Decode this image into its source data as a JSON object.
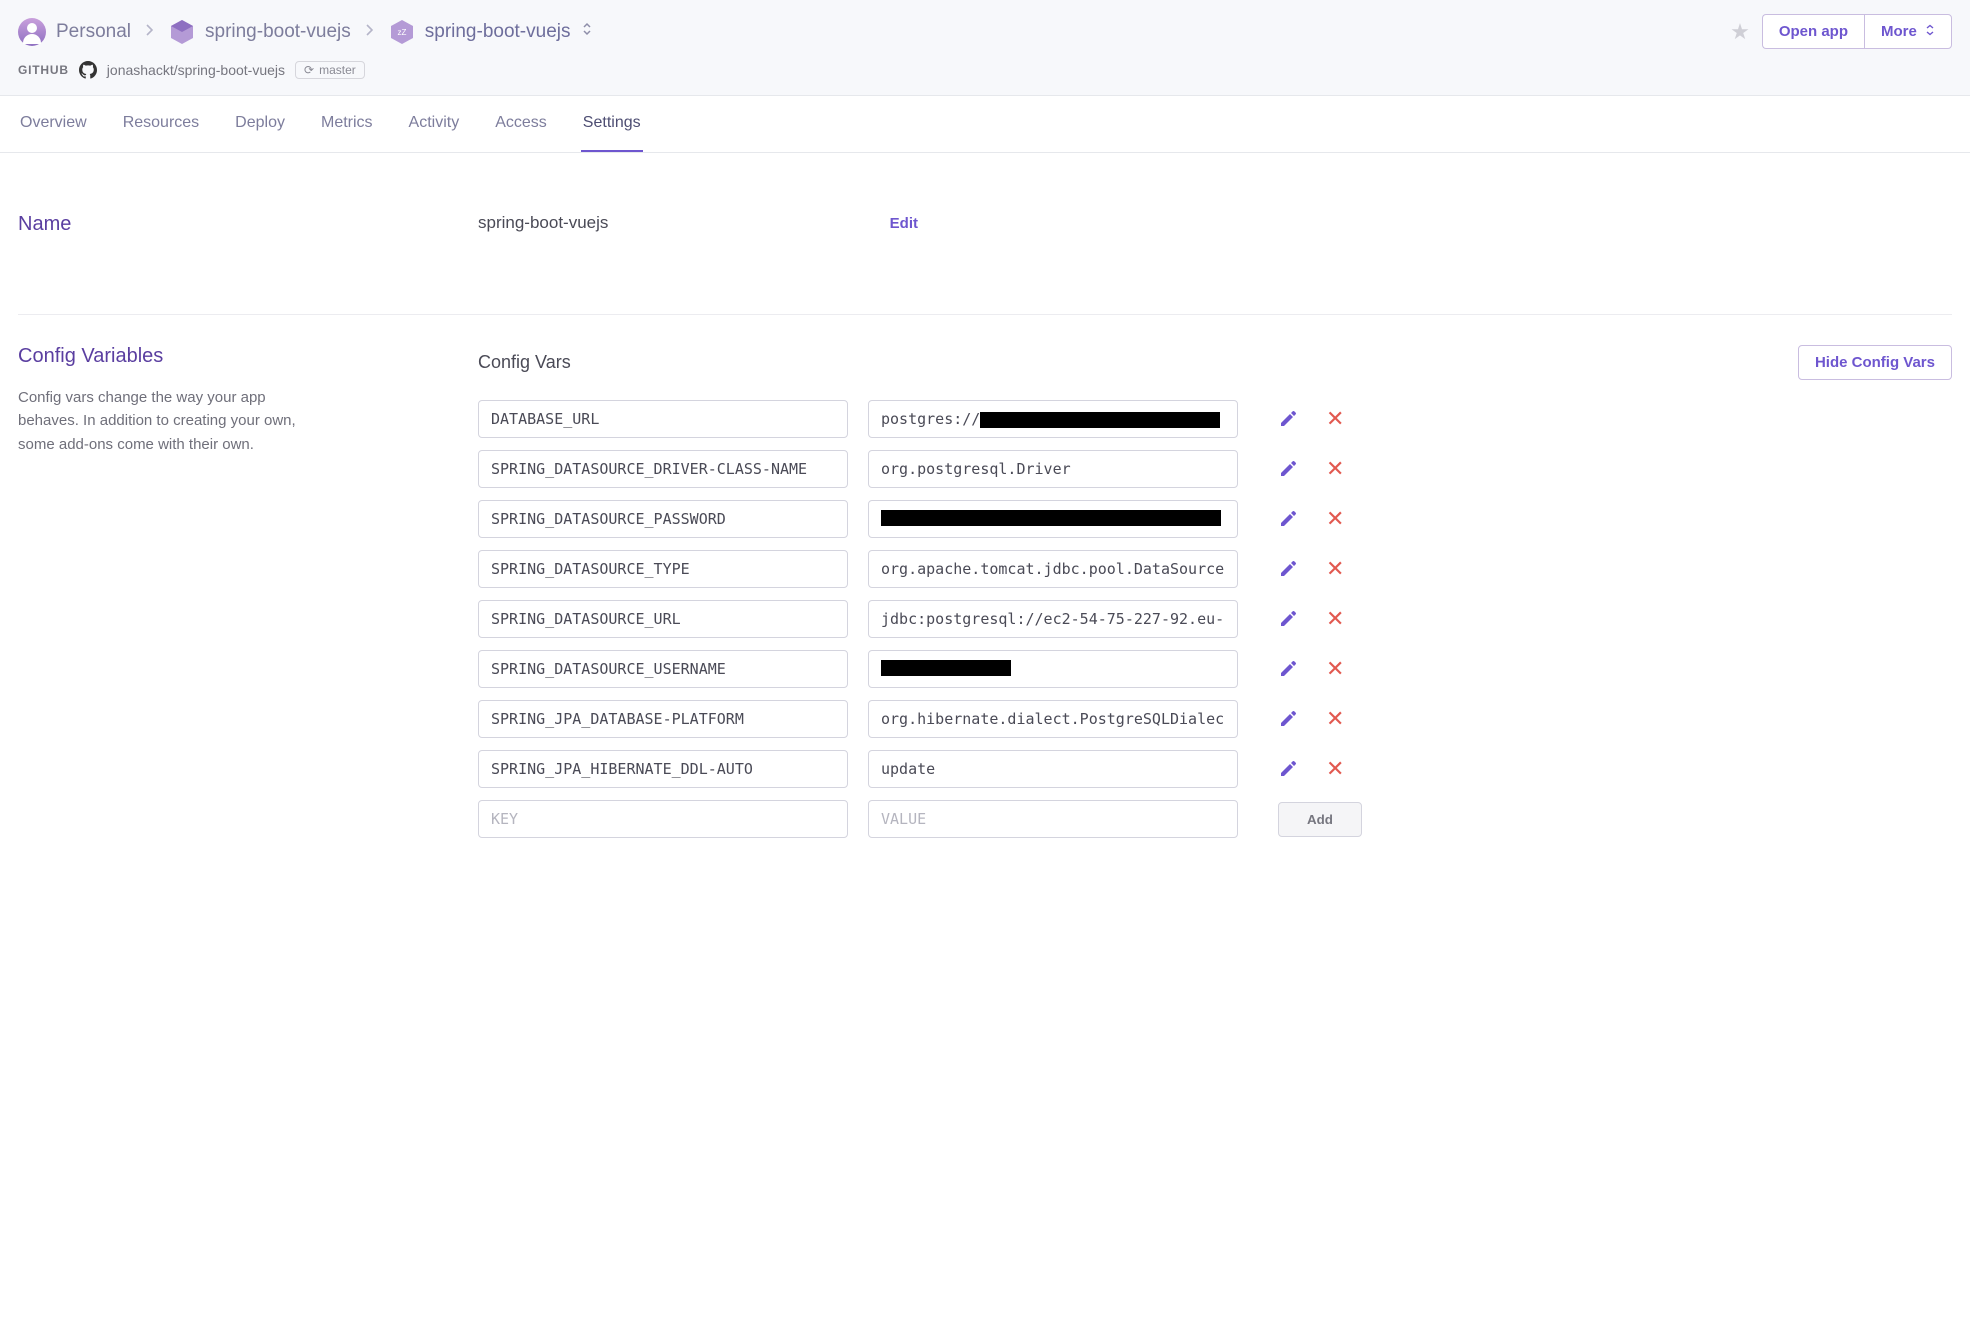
{
  "breadcrumb": {
    "personal": "Personal",
    "pipeline": "spring-boot-vuejs",
    "app": "spring-boot-vuejs"
  },
  "header": {
    "open_app": "Open app",
    "more": "More"
  },
  "source": {
    "label": "GITHUB",
    "repo": "jonashackt/spring-boot-vuejs",
    "branch": "master"
  },
  "tabs": [
    {
      "label": "Overview",
      "active": false
    },
    {
      "label": "Resources",
      "active": false
    },
    {
      "label": "Deploy",
      "active": false
    },
    {
      "label": "Metrics",
      "active": false
    },
    {
      "label": "Activity",
      "active": false
    },
    {
      "label": "Access",
      "active": false
    },
    {
      "label": "Settings",
      "active": true
    }
  ],
  "name_section": {
    "title": "Name",
    "value": "spring-boot-vuejs",
    "edit": "Edit"
  },
  "config_section": {
    "title": "Config Variables",
    "desc": "Config vars change the way your app behaves. In addition to creating your own, some add-ons come with their own.",
    "subtitle": "Config Vars",
    "hide_btn": "Hide Config Vars",
    "add_btn": "Add",
    "key_placeholder": "KEY",
    "value_placeholder": "VALUE",
    "vars": [
      {
        "key": "DATABASE_URL",
        "value": "postgres://",
        "redacted": true,
        "redact_after": "postgres://"
      },
      {
        "key": "SPRING_DATASOURCE_DRIVER-CLASS-NAME",
        "value": "org.postgresql.Driver"
      },
      {
        "key": "SPRING_DATASOURCE_PASSWORD",
        "value": "",
        "redacted": true,
        "full_redact": true
      },
      {
        "key": "SPRING_DATASOURCE_TYPE",
        "value": "org.apache.tomcat.jdbc.pool.DataSource"
      },
      {
        "key": "SPRING_DATASOURCE_URL",
        "value": "jdbc:postgresql://ec2-54-75-227-92.eu-"
      },
      {
        "key": "SPRING_DATASOURCE_USERNAME",
        "value": "",
        "redacted": true,
        "partial_redact": true
      },
      {
        "key": "SPRING_JPA_DATABASE-PLATFORM",
        "value": "org.hibernate.dialect.PostgreSQLDialec"
      },
      {
        "key": "SPRING_JPA_HIBERNATE_DDL-AUTO",
        "value": "update"
      }
    ]
  }
}
